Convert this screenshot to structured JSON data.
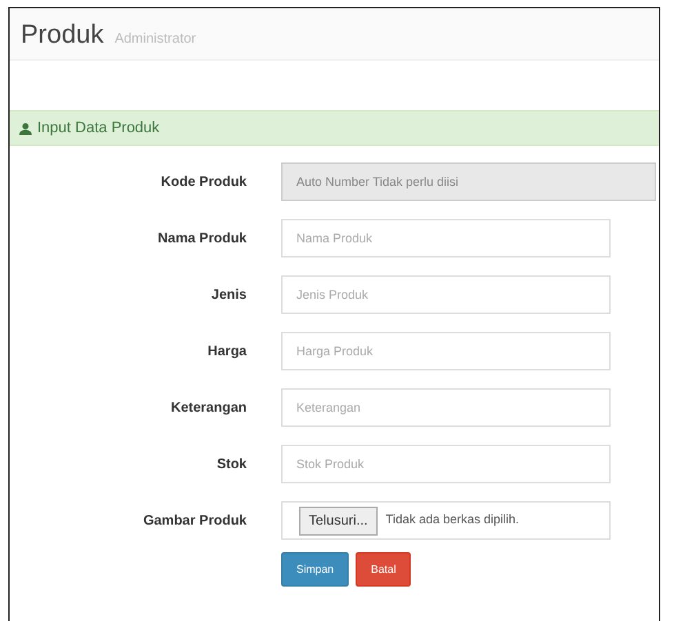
{
  "page": {
    "title": "Produk",
    "subtitle": "Administrator"
  },
  "panel": {
    "title": "Input Data Produk"
  },
  "fields": [
    {
      "label": "Kode Produk",
      "kind": "text",
      "placeholder": "Auto Number Tidak perlu diisi",
      "disabled": true
    },
    {
      "label": "Nama Produk",
      "kind": "text",
      "placeholder": "Nama Produk",
      "disabled": false
    },
    {
      "label": "Jenis",
      "kind": "text",
      "placeholder": "Jenis Produk",
      "disabled": false
    },
    {
      "label": "Harga",
      "kind": "text",
      "placeholder": "Harga Produk",
      "disabled": false
    },
    {
      "label": "Keterangan",
      "kind": "text",
      "placeholder": "Keterangan",
      "disabled": false
    },
    {
      "label": "Stok",
      "kind": "text",
      "placeholder": "Stok Produk",
      "disabled": false
    },
    {
      "label": "Gambar Produk",
      "kind": "file",
      "button": "Telusuri...",
      "status": "Tidak ada berkas dipilih."
    }
  ],
  "buttons": [
    {
      "label": "Simpan",
      "kind": "primary"
    },
    {
      "label": "Batal",
      "kind": "danger"
    }
  ]
}
